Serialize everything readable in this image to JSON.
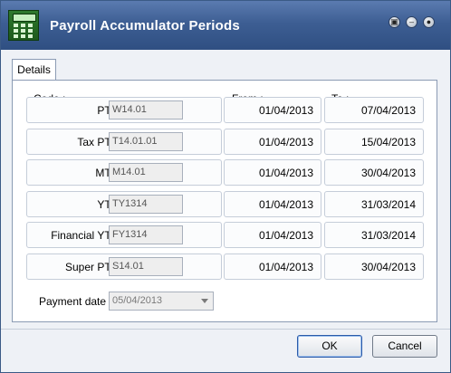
{
  "window": {
    "title": "Payroll Accumulator Periods"
  },
  "tabs": [
    {
      "label": "Details"
    }
  ],
  "headers": {
    "code": "Code :",
    "from": "From :",
    "to": "To :"
  },
  "rows": [
    {
      "label": "PTD :",
      "code": "W14.01",
      "from": "01/04/2013",
      "to": "07/04/2013"
    },
    {
      "label": "Tax PTD :",
      "code": "T14.01.01",
      "from": "01/04/2013",
      "to": "15/04/2013"
    },
    {
      "label": "MTD :",
      "code": "M14.01",
      "from": "01/04/2013",
      "to": "30/04/2013"
    },
    {
      "label": "YTD :",
      "code": "TY1314",
      "from": "01/04/2013",
      "to": "31/03/2014"
    },
    {
      "label": "Financial YTD :",
      "code": "FY1314",
      "from": "01/04/2013",
      "to": "31/03/2014"
    },
    {
      "label": "Super PTD :",
      "code": "S14.01",
      "from": "01/04/2013",
      "to": "30/04/2013"
    }
  ],
  "payment": {
    "label": "Payment date :",
    "value": "05/04/2013"
  },
  "buttons": {
    "ok": "OK",
    "cancel": "Cancel"
  }
}
